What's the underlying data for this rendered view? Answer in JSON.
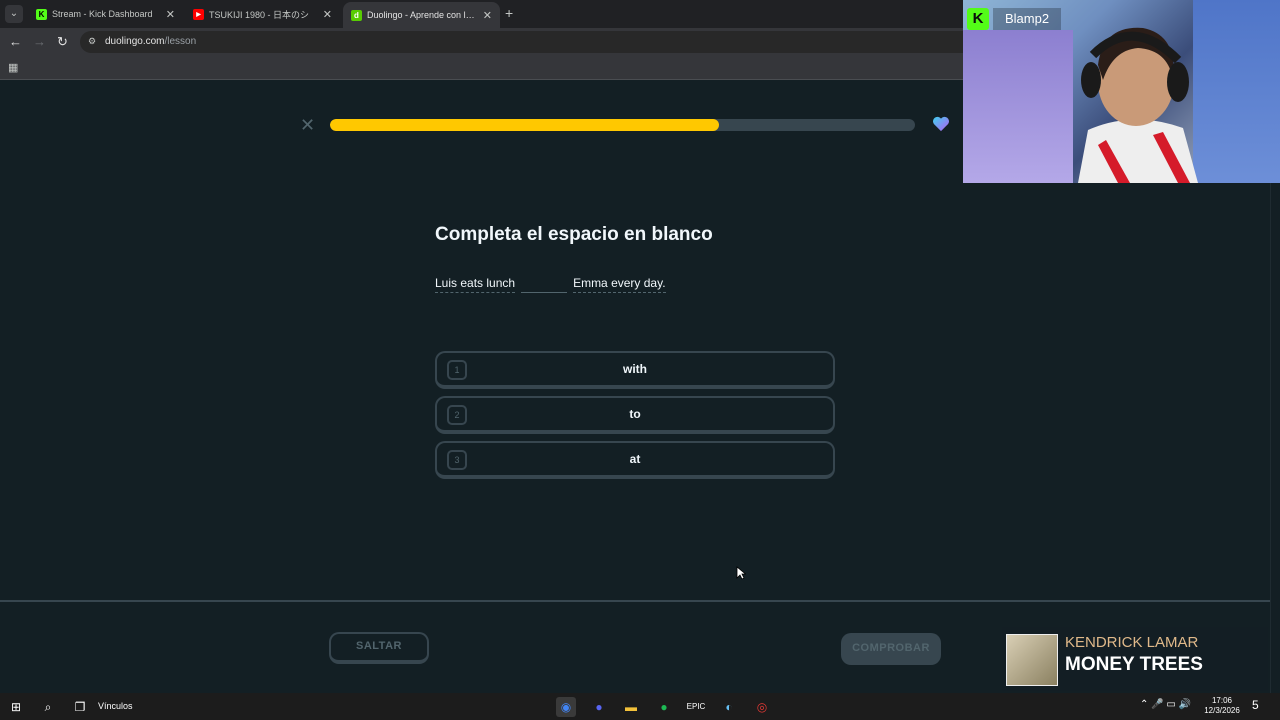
{
  "browser": {
    "tabs": [
      {
        "title": "Stream - Kick Dashboard",
        "favicon": "kick-icon",
        "color": "#53fc18",
        "active": false
      },
      {
        "title": "TSUKIJI 1980 - 日本のシ",
        "favicon": "youtube-icon",
        "color": "#ff0000",
        "active": false
      },
      {
        "title": "Duolingo - Aprende con leccio",
        "favicon": "duolingo-icon",
        "color": "#58cc02",
        "active": true
      }
    ],
    "url_domain": "duolingo.com",
    "url_path": "/lesson"
  },
  "lesson": {
    "progress": 0.665,
    "question": "Completa el espacio en blanco",
    "sentence_before": "Luis eats lunch",
    "sentence_after": "Emma every day.",
    "options": [
      {
        "num": "1",
        "text": "with"
      },
      {
        "num": "2",
        "text": "to"
      },
      {
        "num": "3",
        "text": "at"
      }
    ],
    "skip_label": "SALTAR",
    "check_label": "COMPROBAR"
  },
  "webcam": {
    "logo": "K",
    "name": "Blamp2"
  },
  "now_playing": {
    "artist": "KENDRICK LAMAR",
    "title": "MONEY TREES"
  },
  "taskbar": {
    "label": "Vínculos",
    "time": "17:06",
    "date": "12/3/2026",
    "notifications": "5"
  }
}
